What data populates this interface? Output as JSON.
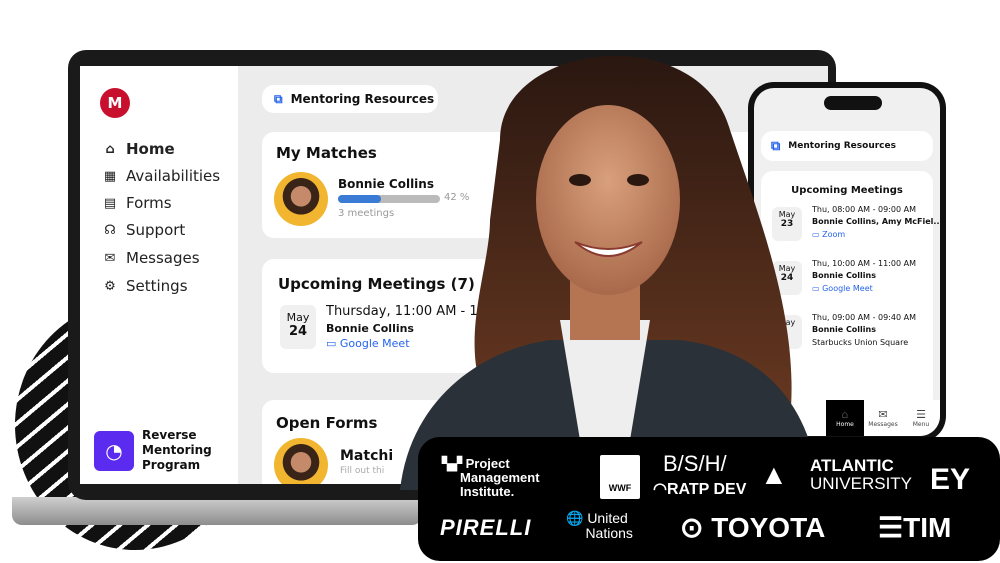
{
  "sidebar": {
    "logo": "M",
    "items": [
      {
        "label": "Home",
        "icon": "home-icon"
      },
      {
        "label": "Availabilities",
        "icon": "calendar-icon"
      },
      {
        "label": "Forms",
        "icon": "form-icon"
      },
      {
        "label": "Support",
        "icon": "headset-icon"
      },
      {
        "label": "Messages",
        "icon": "mail-icon"
      },
      {
        "label": "Settings",
        "icon": "gear-icon"
      }
    ],
    "program": "Reverse Mentoring Program"
  },
  "main": {
    "resources": "Mentoring Resources",
    "matches": {
      "title": "My Matches",
      "name": "Bonnie Collins",
      "progress_percent": 42,
      "progress_label": "42 %",
      "meetings": "3 meetings"
    },
    "upcoming": {
      "title": "Upcoming Meetings (7)",
      "month": "May",
      "day": "24",
      "time": "Thursday, 11:00 AM - 11:3",
      "name": "Bonnie Collins",
      "location": "Google Meet"
    },
    "forms": {
      "title": "Open Forms",
      "item": "Matchi",
      "sub": "Fill out thi"
    },
    "partial": "ment"
  },
  "phone": {
    "resources": "Mentoring Resources",
    "title": "Upcoming Meetings",
    "meetings": [
      {
        "month": "May",
        "day": "23",
        "time": "Thu, 08:00 AM - 09:00 AM",
        "names": "Bonnie Collins, Amy McFiel...",
        "location": "Zoom",
        "video": true
      },
      {
        "month": "May",
        "day": "24",
        "time": "Thu, 10:00 AM - 11:00 AM",
        "names": "Bonnie Collins",
        "location": "Google Meet",
        "video": true
      },
      {
        "month": "May",
        "day": "",
        "time": "Thu, 09:00 AM - 09:40 AM",
        "names": "Bonnie Collins",
        "location": "Starbucks Union Square",
        "video": false
      }
    ],
    "tabs": [
      {
        "label": "Home",
        "active": true
      },
      {
        "label": "Messages"
      },
      {
        "label": "Menu"
      }
    ]
  },
  "logos": [
    "PMI Project Management Institute",
    "WWF",
    "B/S/H/",
    "RATP DEV",
    "ATLANTIC UNIVERSITY",
    "EY",
    "PIRELLI",
    "United Nations",
    "TOYOTA",
    "TIM"
  ],
  "colors": {
    "accent": "#2563eb",
    "brand": "#c8102e",
    "program": "#5b2bf0"
  }
}
